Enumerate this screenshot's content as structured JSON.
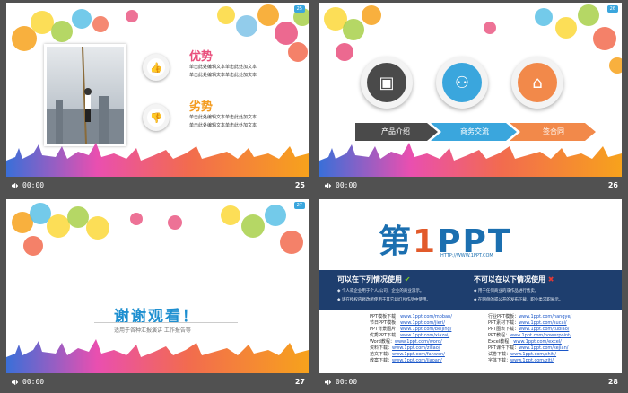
{
  "slides": [
    {
      "number": "25",
      "time": "00:00",
      "tag": "25",
      "advantage_title": "优势",
      "advantage_text": [
        "单击此处编辑文本单击此处加文本",
        "单击此处编辑文本单击此处加文本"
      ],
      "disadvantage_title": "劣势",
      "disadvantage_text": [
        "单击此处编辑文本单击此处加文本",
        "单击此处编辑文本单击此处加文本"
      ]
    },
    {
      "number": "26",
      "time": "00:00",
      "tag": "26",
      "steps": [
        "产品介绍",
        "商务交流",
        "签合同"
      ]
    },
    {
      "number": "27",
      "time": "00:00",
      "tag": "27",
      "thanks": "谢谢观看！",
      "subtitle": "适用于各种汇报演讲 工作报告等"
    },
    {
      "number": "28",
      "time": "00:00",
      "logo_prefix": "第",
      "logo_one": "1",
      "logo_suffix": "PPT",
      "logo_url": "HTTP://WWW.1PPT.COM",
      "can_title": "可以在下列情况使用",
      "can_lines": [
        "◆ 个人或企业用于个人/公司、企业的商业演示。",
        "◆ 请在授权内修改所使用于其它幻灯片作品中使用。"
      ],
      "cannot_title": "不可以在以下情况使用",
      "cannot_lines": [
        "◆ 用于任何商业的或作品进行售卖。",
        "◆ 在网盘的或公开的发布下载，职业类求职展示。"
      ],
      "left_labels": [
        "PPT模板下载：",
        "节日PPT模板：",
        "PPT背景图片：",
        "优秀PPT下载：",
        "Word教程：",
        "资料下载：",
        "范文下载：",
        "教案下载："
      ],
      "left_links": [
        "www.1ppt.com/moban/",
        "www.1ppt.com/jieri/",
        "www.1ppt.com/beijing/",
        "www.1ppt.com/xiazai/",
        "www.1ppt.com/word/",
        "www.1ppt.com/ziliao/",
        "www.1ppt.com/fanwen/",
        "www.1ppt.com/jiaoan/"
      ],
      "right_labels": [
        "行业PPT模板：",
        "PPT素材下载：",
        "PPT图表下载：",
        "PPT教程：",
        "Excel教程：",
        "PPT课件下载：",
        "试卷下载：",
        "字体下载："
      ],
      "right_links": [
        "www.1ppt.com/hangye/",
        "www.1ppt.com/sucai/",
        "www.1ppt.com/tubiao/",
        "www.1ppt.com/powerpoint/",
        "www.1ppt.com/excel/",
        "www.1ppt.com/kejian/",
        "www.1ppt.com/shiti/",
        "www.1ppt.com/ziti/"
      ]
    }
  ],
  "colors": {
    "orange": "#f39b1f",
    "pink": "#e94f7c",
    "blue": "#3aa6dd",
    "dark": "#4a4a4a",
    "navy": "#1e3e6e"
  }
}
